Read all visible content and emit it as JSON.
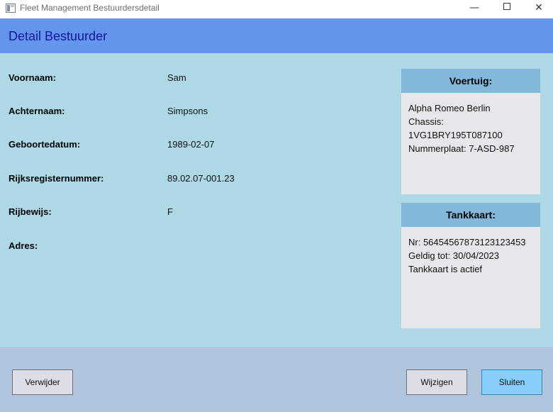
{
  "window": {
    "title": "Fleet Management Bestuurdersdetail",
    "controls": {
      "minimize": "—",
      "close": "✕"
    }
  },
  "header": {
    "title": "Detail Bestuurder"
  },
  "fields": [
    {
      "label": "Voornaam:",
      "value": "Sam"
    },
    {
      "label": "Achternaam:",
      "value": "Simpsons"
    },
    {
      "label": "Geboortedatum:",
      "value": "1989-02-07"
    },
    {
      "label": "Rijksregisternummer:",
      "value": "89.02.07-001.23"
    },
    {
      "label": "Rijbewijs:",
      "value": "F"
    },
    {
      "label": "Adres:",
      "value": ""
    }
  ],
  "vehicle_card": {
    "title": "Voertuig:",
    "lines": [
      "Alpha Romeo Berlin",
      "Chassis:",
      "1VG1BRY195T087100",
      "Nummerplaat: 7-ASD-987"
    ]
  },
  "fuel_card": {
    "title": "Tankkaart:",
    "lines": [
      "Nr: 56454567873123123453",
      "Geldig tot: 30/04/2023",
      "Tankkaart is actief"
    ]
  },
  "buttons": {
    "delete": "Verwijder",
    "edit": "Wijzigen",
    "close": "Sluiten"
  },
  "colors": {
    "header": "#6495ed",
    "content_background": "#add8e6",
    "footer": "#b0c4de",
    "card_header": "#83b8da",
    "primary_button": "#87cefa"
  }
}
